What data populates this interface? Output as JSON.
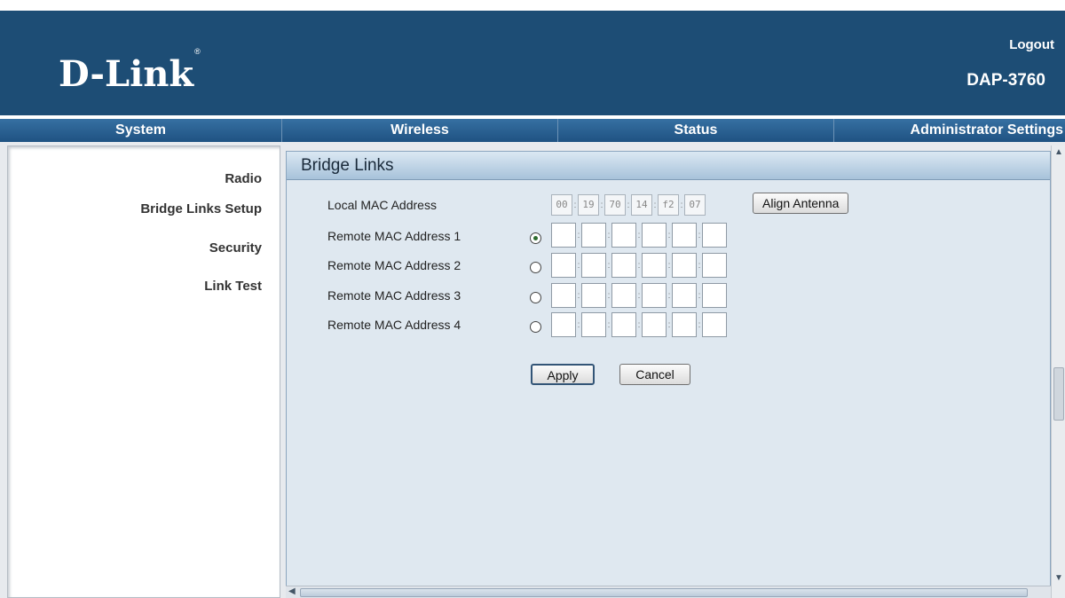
{
  "header": {
    "logo_text": "D-Link",
    "logo_mark": "®",
    "logout_label": "Logout",
    "model": "DAP-3760"
  },
  "nav": {
    "tabs": [
      {
        "label": "System"
      },
      {
        "label": "Wireless"
      },
      {
        "label": "Status"
      },
      {
        "label": "Administrator Settings"
      }
    ]
  },
  "sidebar": {
    "items": [
      {
        "label": "Radio"
      },
      {
        "label": "Bridge Links Setup"
      },
      {
        "label": "Security"
      },
      {
        "label": "Link Test"
      }
    ]
  },
  "main": {
    "title": "Bridge Links",
    "local_mac_label": "Local MAC Address",
    "local_mac": [
      "00",
      "19",
      "70",
      "14",
      "f2",
      "07"
    ],
    "align_button": "Align Antenna",
    "remote_rows": [
      {
        "label": "Remote MAC Address 1",
        "selected": true,
        "values": [
          "",
          "",
          "",
          "",
          "",
          ""
        ]
      },
      {
        "label": "Remote MAC Address 2",
        "selected": false,
        "values": [
          "",
          "",
          "",
          "",
          "",
          ""
        ]
      },
      {
        "label": "Remote MAC Address 3",
        "selected": false,
        "values": [
          "",
          "",
          "",
          "",
          "",
          ""
        ]
      },
      {
        "label": "Remote MAC Address 4",
        "selected": false,
        "values": [
          "",
          "",
          "",
          "",
          "",
          ""
        ]
      }
    ],
    "apply_label": "Apply",
    "cancel_label": "Cancel"
  },
  "colors": {
    "header_bg": "#1d4d75",
    "nav_bg": "#2b5e8b",
    "panel_bg": "#dfe8f0"
  }
}
